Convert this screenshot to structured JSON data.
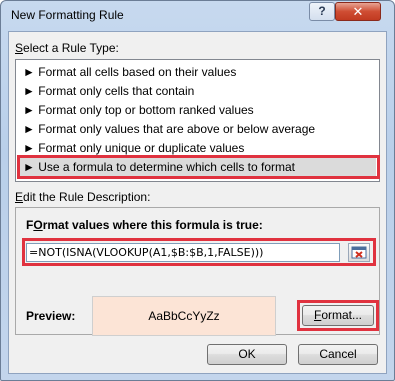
{
  "window": {
    "title": "New Formatting Rule",
    "help_label": "?",
    "close_label": "✕"
  },
  "rule_type": {
    "heading_prefix": "",
    "heading_accel": "S",
    "heading_rest": "elect a Rule Type:",
    "items": [
      {
        "arrow": "►",
        "label": "Format all cells based on their values"
      },
      {
        "arrow": "►",
        "label": "Format only cells that contain"
      },
      {
        "arrow": "►",
        "label": "Format only top or bottom ranked values"
      },
      {
        "arrow": "►",
        "label": "Format only values that are above or below average"
      },
      {
        "arrow": "►",
        "label": "Format only unique or duplicate values"
      },
      {
        "arrow": "►",
        "label": "Use a formula to determine which cells to format"
      }
    ],
    "selected_index": 5
  },
  "description": {
    "heading_accel": "E",
    "heading_rest": "dit the Rule Description:",
    "formula_label_accel": "O",
    "formula_label_pre": "F",
    "formula_label_rest": "rmat values where this formula is true:",
    "formula_value": "=NOT(ISNA(VLOOKUP(A1,$B:$B,1,FALSE)))",
    "preview_label": "Preview:",
    "preview_sample": "AaBbCcYyZz",
    "format_button_accel": "F",
    "format_button_rest": "ormat..."
  },
  "buttons": {
    "ok": "OK",
    "cancel": "Cancel"
  },
  "colors": {
    "highlight": "#e0323f",
    "preview_fill": "#fce4d6"
  }
}
